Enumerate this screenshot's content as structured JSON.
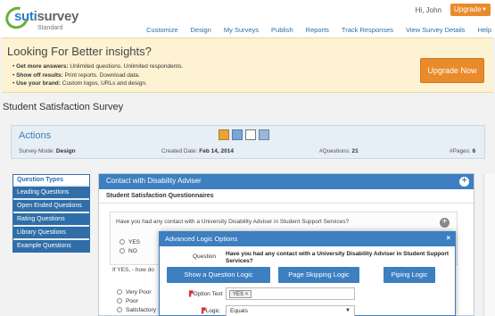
{
  "header": {
    "logo_brand_1": "suti",
    "logo_brand_2": "survey",
    "logo_sub": "Standard",
    "greeting": "Hi, John",
    "upgrade_pill": "Upgrade",
    "nav": [
      "Customize",
      "Design",
      "My Surveys",
      "Publish",
      "Reports",
      "Track Responses",
      "View Survey Details",
      "Help"
    ]
  },
  "banner": {
    "title": "Looking For Better insights?",
    "items": [
      {
        "bold": "Get more answers:",
        "text": " Unlimited questions. Unlimited respondents."
      },
      {
        "bold": "Show off results:",
        "text": " Print reports. Download data."
      },
      {
        "bold": "Use your brand:",
        "text": " Custom logos, URLs and design."
      }
    ],
    "upgrade_button": "Upgrade Now"
  },
  "page_title": "Student Satisfaction Survey",
  "actions": {
    "title": "Actions",
    "survey_mode_label": "Survey Mode:",
    "survey_mode": "Design",
    "created_label": "Created Date:",
    "created": "Feb 14, 2014",
    "questions_label": "#Questions:",
    "questions": "21",
    "pages_label": "#Pages:",
    "pages": "6"
  },
  "question_types": {
    "title": "Question Types",
    "items": [
      "Leading Questions",
      "Open Ended Questions",
      "Rating Questions",
      "Library Questions",
      "Example Questions"
    ]
  },
  "panel": {
    "title": "Contact with Disability Adviser",
    "subtitle": "Student Satisfaction Questionnaires",
    "question": "Have you had any contact with a University Disability Adviser in Student Support Services?",
    "options": [
      "YES",
      "NO"
    ],
    "question2": "If YES, - how do",
    "options2": [
      "Very Poor",
      "Poor",
      "Satisfactory"
    ]
  },
  "modal": {
    "title": "Advanced Logic Options",
    "close": "×",
    "question_label": "Question",
    "question_text": "Have you had any contact with a University Disability Adviser in Student Support Services?",
    "buttons": [
      "Show a Question Logic",
      "Page Skipping Logic",
      "Piping Logic"
    ],
    "option_text_label": "Option Text",
    "option_tag": "YES",
    "option_tag_remove": "×",
    "logic_label": "Logic",
    "logic_value": "Equals"
  },
  "colors": {
    "brand_blue": "#3d7fc0",
    "accent_orange": "#e98a2b",
    "banner_bg": "#fdf3d3"
  }
}
